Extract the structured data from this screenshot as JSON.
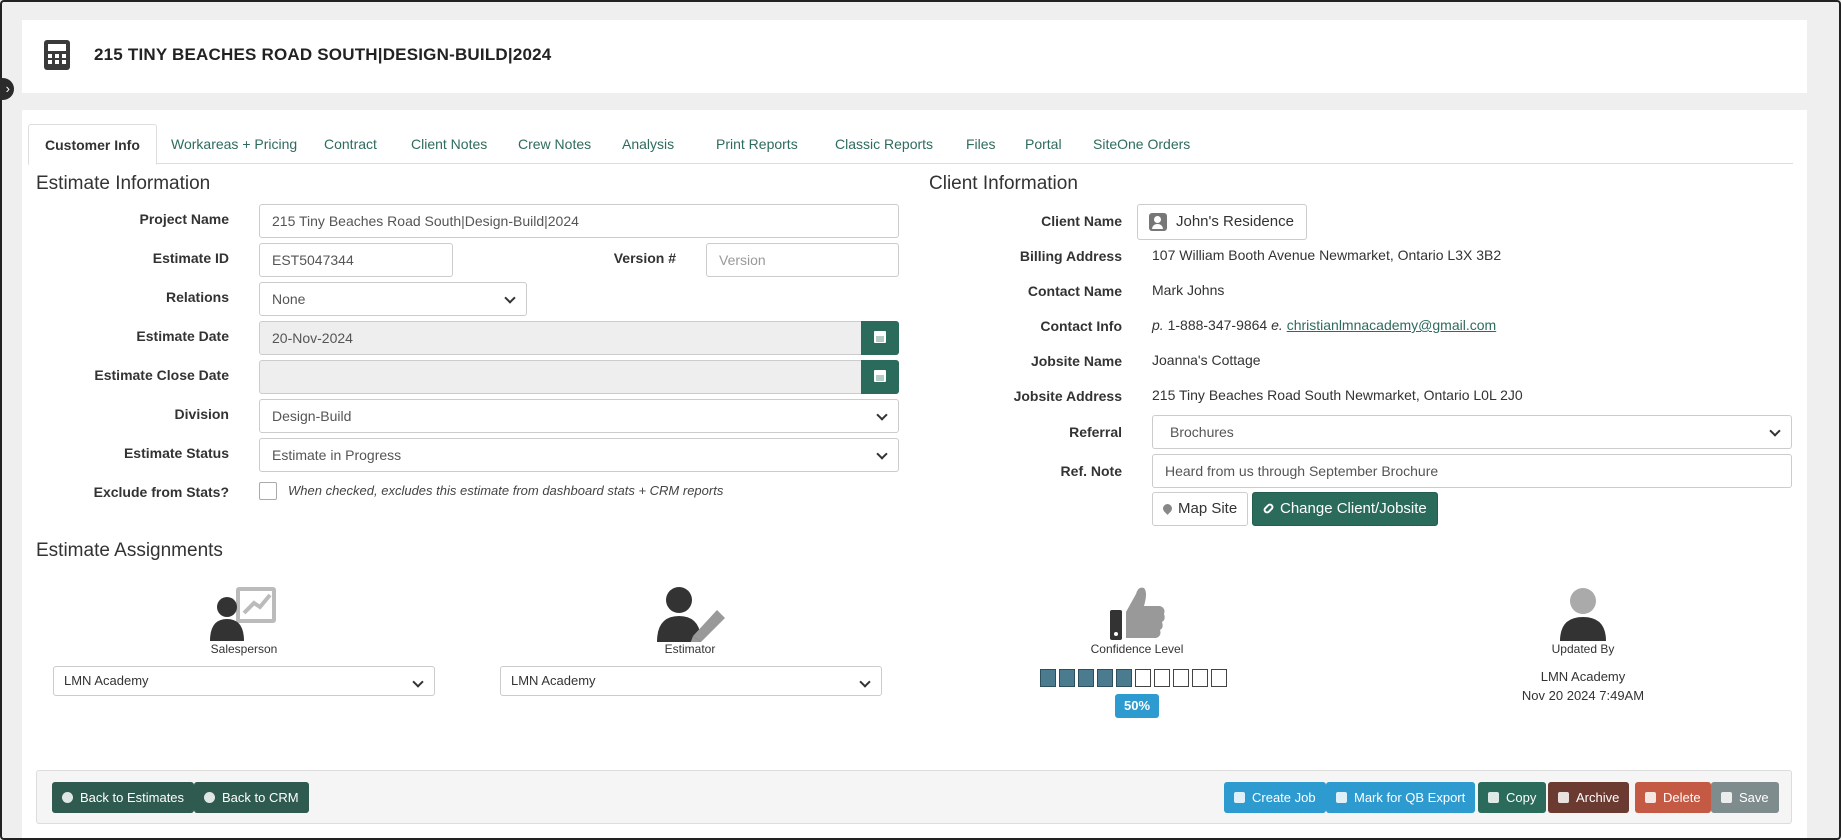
{
  "header": {
    "title": "215 TINY BEACHES ROAD SOUTH|DESIGN-BUILD|2024",
    "icon": "calculator-icon"
  },
  "tabs": [
    {
      "label": "Customer Info",
      "active": true
    },
    {
      "label": "Workareas + Pricing"
    },
    {
      "label": "Contract"
    },
    {
      "label": "Client Notes"
    },
    {
      "label": "Crew Notes"
    },
    {
      "label": "Analysis"
    },
    {
      "label": "Print Reports"
    },
    {
      "label": "Classic Reports"
    },
    {
      "label": "Files"
    },
    {
      "label": "Portal"
    },
    {
      "label": "SiteOne Orders"
    }
  ],
  "estimate": {
    "section_title": "Estimate Information",
    "project_name_label": "Project Name",
    "project_name": "215 Tiny Beaches Road South|Design-Build|2024",
    "estimate_id_label": "Estimate ID",
    "estimate_id": "EST5047344",
    "version_label": "Version #",
    "version_placeholder": "Version",
    "relations_label": "Relations",
    "relations": "None",
    "estimate_date_label": "Estimate Date",
    "estimate_date": "20-Nov-2024",
    "close_date_label": "Estimate Close Date",
    "close_date": "",
    "division_label": "Division",
    "division": "Design-Build",
    "status_label": "Estimate Status",
    "status": "Estimate in Progress",
    "exclude_label": "Exclude from Stats?",
    "exclude_hint": "When checked, excludes this estimate from dashboard stats + CRM reports",
    "exclude_checked": false
  },
  "client": {
    "section_title": "Client Information",
    "client_name_label": "Client Name",
    "client_name": "John's Residence",
    "billing_label": "Billing Address",
    "billing": "107 William Booth Avenue Newmarket, Ontario L3X 3B2",
    "contact_name_label": "Contact Name",
    "contact_name": "Mark Johns",
    "contact_info_label": "Contact Info",
    "phone_prefix": "p.",
    "phone": "1-888-347-9864",
    "email_prefix": "e.",
    "email": "christianlmnacademy@gmail.com",
    "jobsite_name_label": "Jobsite Name",
    "jobsite_name": "Joanna's Cottage",
    "jobsite_address_label": "Jobsite Address",
    "jobsite_address": "215 Tiny Beaches Road South Newmarket, Ontario L0L 2J0",
    "referral_label": "Referral",
    "referral": "Brochures",
    "ref_note_label": "Ref. Note",
    "ref_note": "Heard from us through September Brochure",
    "map_site_label": "Map Site",
    "change_label": "Change Client/Jobsite"
  },
  "assignments": {
    "section_title": "Estimate Assignments",
    "salesperson_label": "Salesperson",
    "salesperson": "LMN Academy",
    "estimator_label": "Estimator",
    "estimator": "LMN Academy",
    "confidence_label": "Confidence Level",
    "confidence_percent": 50,
    "confidence_text": "50%",
    "updated_by_label": "Updated By",
    "updated_by": "LMN Academy",
    "updated_at": "Nov 20 2024 7:49AM"
  },
  "footer": {
    "back_estimates": "Back to Estimates",
    "back_crm": "Back to CRM",
    "create_job": "Create Job",
    "mark_qb": "Mark for QB Export",
    "copy": "Copy",
    "archive": "Archive",
    "delete": "Delete",
    "save": "Save"
  },
  "colors": {
    "accent": "#2a6b5b",
    "info": "#2d9ad0",
    "danger": "#c45a44",
    "archive": "#6b3a30"
  }
}
